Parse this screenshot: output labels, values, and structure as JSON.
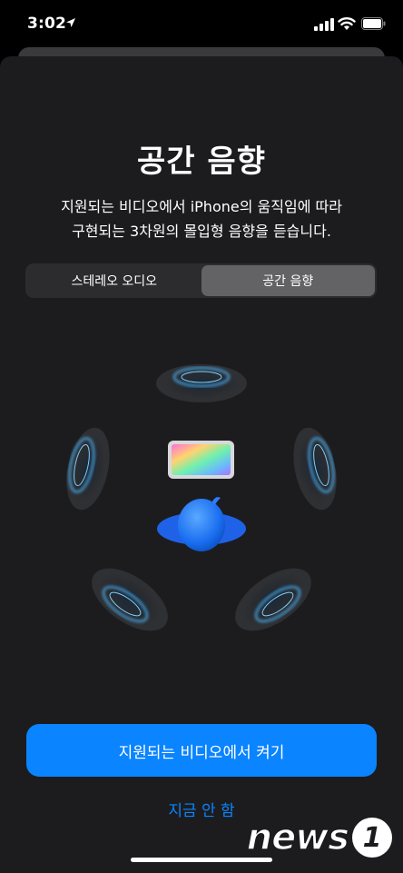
{
  "status_bar": {
    "time": "3:02",
    "icons": [
      "location-arrow-icon",
      "cellular-signal-icon",
      "wifi-icon",
      "battery-icon"
    ]
  },
  "sheet": {
    "title": "공간 음향",
    "description_line1": "지원되는 비디오에서 iPhone의 움직임에 따라",
    "description_line2": "구현되는 3차원의 몰입형 음향을 듣습니다."
  },
  "segmented_control": {
    "options": [
      {
        "label": "스테레오 오디오",
        "selected": false
      },
      {
        "label": "공간 음향",
        "selected": true
      }
    ]
  },
  "buttons": {
    "primary": "지원되는 비디오에서 켜기",
    "secondary": "지금 안 함"
  },
  "watermark": {
    "text": "news",
    "badge": "1"
  },
  "colors": {
    "accent": "#0a84ff",
    "sheet_bg": "#1c1c1e",
    "segment_bg": "#2c2c2e",
    "segment_selected": "#636366",
    "ring_glow": "#5ac8fa"
  }
}
